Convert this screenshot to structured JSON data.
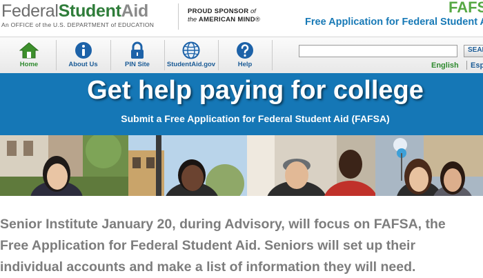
{
  "header": {
    "logo": {
      "federal": "Federal",
      "student": "Student",
      "aid": "Aid",
      "tagline": "An OFFICE of the U.S. DEPARTMENT of EDUCATION"
    },
    "sponsor": {
      "line1_bold": "PROUD SPONSOR",
      "line1_rest": " of",
      "line2_prefix": "the ",
      "line2_bold": "AMERICAN MIND",
      "line2_suffix": "®"
    },
    "fafsa_logo": "FAFSA",
    "fafsa_subtitle": "Free Application for Federal Student Aid"
  },
  "nav": {
    "items": [
      {
        "label": "Home",
        "icon": "home-icon"
      },
      {
        "label": "About Us",
        "icon": "info-icon"
      },
      {
        "label": "PIN Site",
        "icon": "lock-icon"
      },
      {
        "label": "StudentAid.gov",
        "icon": "globe-icon"
      },
      {
        "label": "Help",
        "icon": "help-icon"
      }
    ],
    "search": {
      "value": "",
      "button": "SEARCH"
    },
    "languages": {
      "english": "English",
      "spanish": "Español"
    }
  },
  "hero": {
    "title": "Get help paying for college",
    "subtitle": "Submit a Free Application for Federal Student Aid (FAFSA)"
  },
  "body": {
    "lines": [
      "Senior Institute January 20, during Advisory, will focus on FAFSA, the",
      "Free Application for Federal Student Aid. Seniors will set up their",
      "individual accounts and make a list of information they will need."
    ]
  },
  "colors": {
    "brand_green": "#2f7d3a",
    "brand_blue": "#1577b6",
    "link_blue": "#1b5b96"
  }
}
